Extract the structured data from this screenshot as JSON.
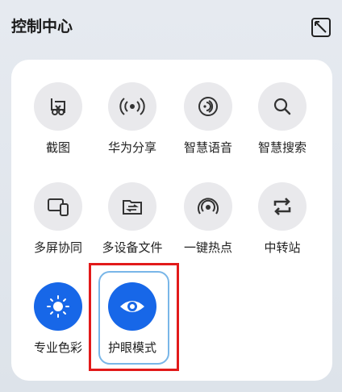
{
  "header": {
    "title": "控制中心",
    "edit_icon": "edit-layout-icon"
  },
  "tiles": [
    {
      "label": "截图",
      "icon": "screenshot-scissors-icon",
      "active": false
    },
    {
      "label": "华为分享",
      "icon": "share-wireless-icon",
      "active": false
    },
    {
      "label": "智慧语音",
      "icon": "voice-assistant-icon",
      "active": false
    },
    {
      "label": "智慧搜索",
      "icon": "search-icon",
      "active": false
    },
    {
      "label": "多屏协同",
      "icon": "multi-screen-icon",
      "active": false
    },
    {
      "label": "多设备文件",
      "icon": "file-transfer-icon",
      "active": false
    },
    {
      "label": "一键热点",
      "icon": "hotspot-icon",
      "active": false
    },
    {
      "label": "中转站",
      "icon": "transfer-station-icon",
      "active": false
    },
    {
      "label": "专业色彩",
      "icon": "pro-color-sun-icon",
      "active": true
    },
    {
      "label": "护眼模式",
      "icon": "eye-comfort-icon",
      "active": true
    }
  ],
  "highlight": {
    "tile_label": "护眼模式",
    "color": "#e21a1a"
  },
  "colors": {
    "accent": "#1767e8",
    "tile_bg": "#e9e9ec"
  }
}
